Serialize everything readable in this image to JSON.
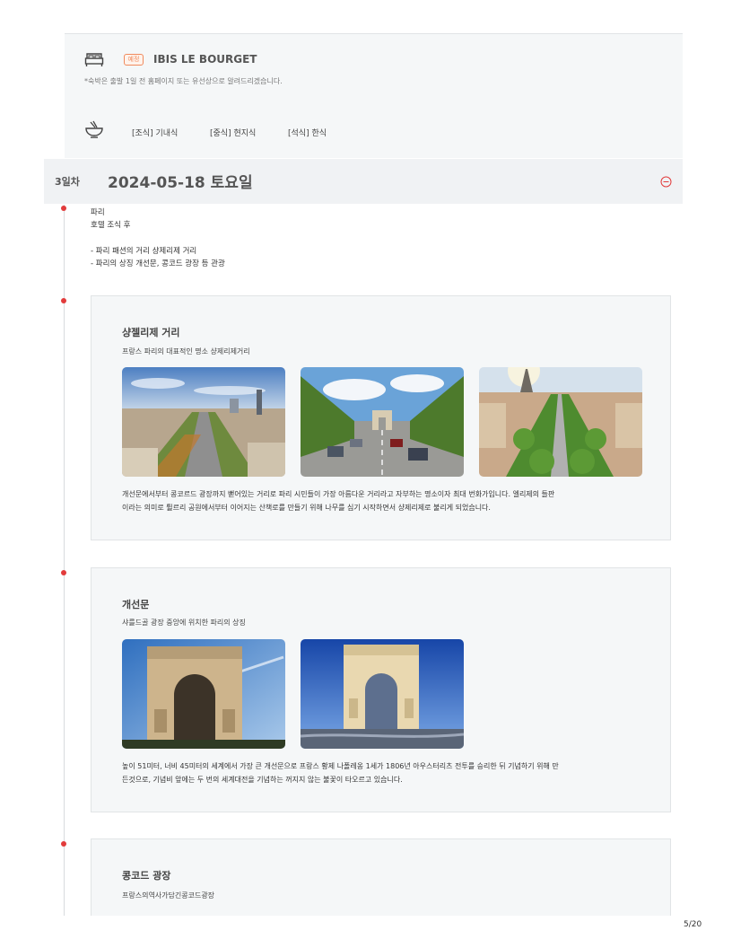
{
  "hotel": {
    "badge": "예정",
    "name": "IBIS LE BOURGET",
    "note": "*숙박은 출발 1일 전 홈페이지 또는 유선상으로 알려드리겠습니다."
  },
  "meals": [
    "[조식] 기내식",
    "[중식] 현지식",
    "[석식] 한식"
  ],
  "day": {
    "label": "3일차",
    "date": "2024-05-18 토요일"
  },
  "schedule": {
    "city": "파리",
    "lines": [
      "호텔 조식 후",
      "- 파리 패션의 거리 샹제리제 거리",
      "- 파리의 상징 개선문, 콩코드 광장 등 관광"
    ]
  },
  "places": [
    {
      "title": "샹젤리제 거리",
      "subtitle": "프랑스 파리의 대표적인 명소 샹제리제거리",
      "photos": [
        "champs-elysees-aerial-photo",
        "champs-elysees-street-photo",
        "champs-elysees-eiffel-view-photo"
      ],
      "desc_lines": [
        "개선문에서부터 콩코르드 광장까지 뻗어있는 거리로 파리 시민들이 가장 아름다운 거리라고 자부하는 명소이자 최대 번화가입니다. 엘리제의 들판",
        "이라는 의미로 튈르리 공원에서부터 이어지는 산책로를 만들기 위해 나무를 심기 시작하면서 샹제리제로 불리게 되었습니다."
      ]
    },
    {
      "title": "개선문",
      "subtitle": "샤를드골 광장 중앙에 위치한 파리의 상징",
      "photos": [
        "arc-de-triomphe-sky-photo",
        "arc-de-triomphe-blue-photo"
      ],
      "desc_lines": [
        "높이 51미터, 너비 45미터의 세계에서 가장 큰 개선문으로 프랑스 황제 나폴레옹 1세가 1806년 아우스터리츠 전투를 승리한 뒤 기념하기 위해 만",
        "든것으로, 기념비 앞에는 두 번의 세계대전을 기념하는 꺼지지 않는 불꽃이 타오르고 있습니다."
      ]
    },
    {
      "title": "콩코드 광장",
      "subtitle": "프랑스의역사가담긴콩코드광장"
    }
  ],
  "page": "5/20",
  "icons": {
    "hotel": "bed-icon",
    "meal": "bowl-icon",
    "collapse": "minus-circle-icon"
  },
  "colors": {
    "accent_red": "#e23b3b",
    "badge_orange": "#f08a5d"
  }
}
